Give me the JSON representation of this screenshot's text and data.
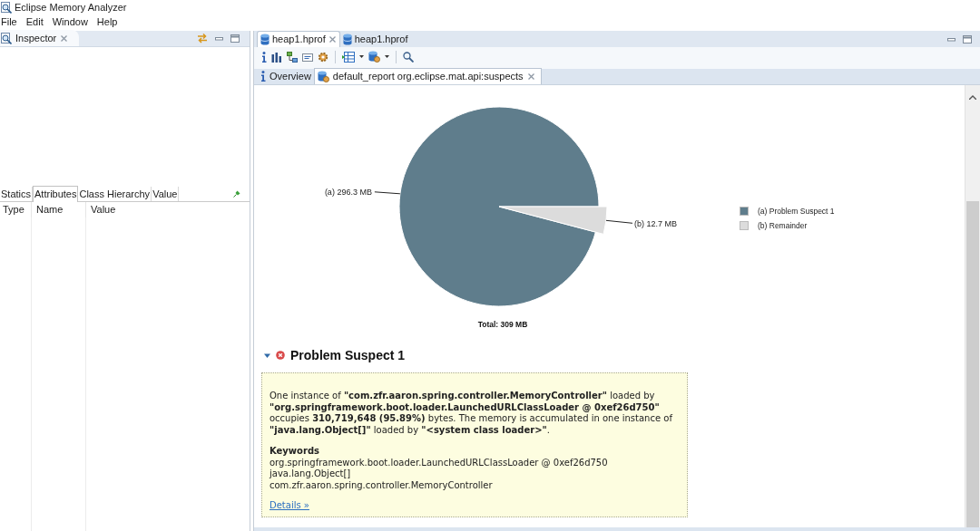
{
  "window": {
    "title": "Eclipse Memory Analyzer"
  },
  "menu": [
    "File",
    "Edit",
    "Window",
    "Help"
  ],
  "inspector": {
    "title": "Inspector",
    "tabs": [
      {
        "label": "Statics",
        "selected": false
      },
      {
        "label": "Attributes",
        "selected": true
      },
      {
        "label": "Class Hierarchy",
        "selected": false
      },
      {
        "label": "Value",
        "selected": false
      }
    ],
    "columns": [
      "Type",
      "Name",
      "Value"
    ]
  },
  "editor": {
    "tabs": [
      {
        "label": "heap1.hprof",
        "selected": true
      },
      {
        "label": "heap1.hprof",
        "selected": false
      }
    ],
    "report_tabs": [
      {
        "kind": "info",
        "label": "Overview",
        "selected": false
      },
      {
        "kind": "report",
        "label": "default_report org.eclipse.mat.api:suspects",
        "selected": true
      }
    ],
    "chart_data": {
      "type": "pie",
      "title": "Total: 309 MB",
      "categories": [
        "(a) Problem Suspect 1",
        "(b) Remainder"
      ],
      "values": [
        296.3,
        12.7
      ],
      "colors": [
        "#5f7d8c",
        "#dcdcdc"
      ],
      "value_labels": [
        "(a) 296.3 MB",
        "(b) 12.7 MB"
      ],
      "legend": "right"
    },
    "suspect": {
      "title": "Problem Suspect 1",
      "expanded": true,
      "description": "One instance of **\"com.zfr.aaron.spring.controller.MemoryController\"** loaded by **\"org.springframework.boot.loader.LaunchedURLClassLoader @ 0xef26d750\"** occupies **310,719,648 (95.89%)** bytes. The memory is accumulated in one instance of **\"java.lang.Object[]\"** loaded by **\"<system class loader>\"**.",
      "keywords_title": "Keywords",
      "keywords": [
        "org.springframework.boot.loader.LaunchedURLClassLoader @ 0xef26d750",
        "java.lang.Object[]",
        "com.zfr.aaron.spring.controller.MemoryController"
      ],
      "link": "Details »"
    }
  }
}
